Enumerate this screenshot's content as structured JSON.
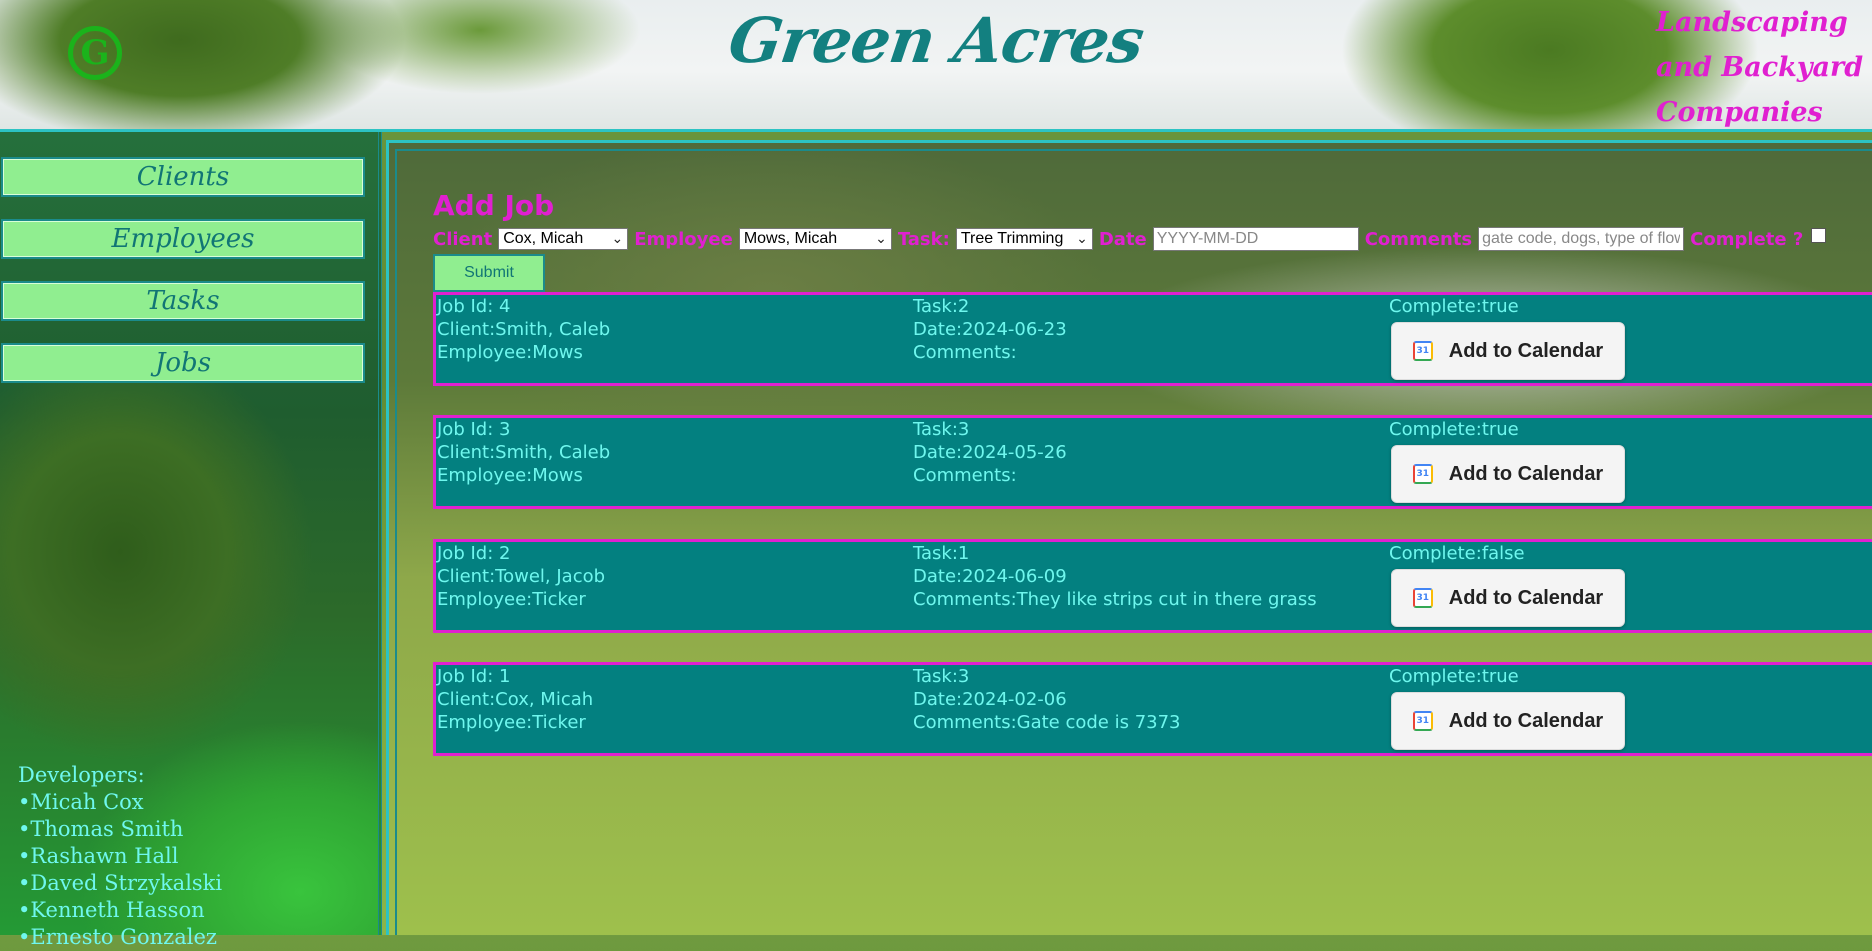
{
  "header": {
    "logo_text": "G",
    "brand": "Green Acres",
    "tagline_lines": [
      "Landscaping",
      "and Backyard Care",
      "Companies"
    ]
  },
  "sidebar": {
    "items": [
      {
        "label": "Clients"
      },
      {
        "label": "Employees"
      },
      {
        "label": "Tasks"
      },
      {
        "label": "Jobs"
      }
    ],
    "developers_title": "Developers:",
    "developers": [
      "•Micah Cox",
      "•Thomas Smith",
      "•Rashawn Hall",
      "•Daved Strzykalski",
      "•Kenneth Hasson",
      "•Ernesto Gonzalez"
    ]
  },
  "form": {
    "title": "Add Job",
    "client_label": "Client",
    "client_value": "Cox, Micah",
    "employee_label": "Employee",
    "employee_value": "Mows, Micah",
    "task_label": "Task:",
    "task_value": "Tree Trimming",
    "date_label": "Date",
    "date_placeholder": "YYYY-MM-DD",
    "comments_label": "Comments",
    "comments_placeholder": "gate code, dogs, type of flowers",
    "complete_label": "Complete ?",
    "submit_label": "Submit"
  },
  "calendar_button_label": "Add to Calendar",
  "jobs": [
    {
      "id": "Job Id: 4",
      "client": "Client:Smith, Caleb",
      "employee": "Employee:Mows",
      "task": "Task:2",
      "date": "Date:2024-06-23",
      "comments": "Comments:",
      "complete": "Complete:true"
    },
    {
      "id": "Job Id: 3",
      "client": "Client:Smith, Caleb",
      "employee": "Employee:Mows",
      "task": "Task:3",
      "date": "Date:2024-05-26",
      "comments": "Comments:",
      "complete": "Complete:true"
    },
    {
      "id": "Job Id: 2",
      "client": "Client:Towel, Jacob",
      "employee": "Employee:Ticker",
      "task": "Task:1",
      "date": "Date:2024-06-09",
      "comments": "Comments:They like strips cut in there grass",
      "complete": "Complete:false"
    },
    {
      "id": "Job Id: 1",
      "client": "Client:Cox, Micah",
      "employee": "Employee:Ticker",
      "task": "Task:3",
      "date": "Date:2024-02-06",
      "comments": "Comments:Gate code is 7373",
      "complete": "Complete:true"
    }
  ],
  "colors": {
    "accent_magenta": "#e020d0",
    "teal": "#038080",
    "cyan_text": "#6ff7ee",
    "nav_green": "#90ee90"
  }
}
